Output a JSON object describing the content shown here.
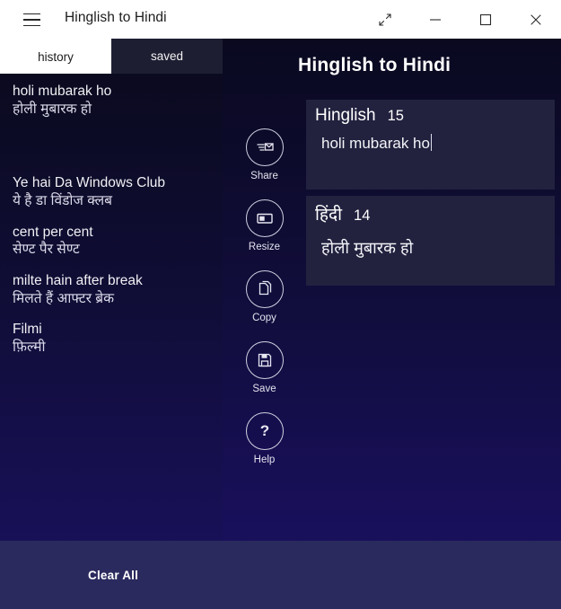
{
  "window": {
    "title": "Hinglish to Hindi",
    "menu_icon": "hamburger-icon",
    "buttons": [
      {
        "name": "restore-fullscreen-button",
        "icon": "diagonal-arrows-icon",
        "label": ""
      },
      {
        "name": "minimize-button",
        "icon": "minimize-icon",
        "label": ""
      },
      {
        "name": "maximize-button",
        "icon": "maximize-icon",
        "label": ""
      },
      {
        "name": "close-button",
        "icon": "close-icon",
        "label": ""
      }
    ]
  },
  "tabs": [
    {
      "label": "history",
      "active": true
    },
    {
      "label": "saved",
      "active": false
    }
  ],
  "history": [
    {
      "source": "holi mubarak ho",
      "target": "होली मुबारक हो"
    },
    {
      "source": "",
      "target": ""
    },
    {
      "source": "Ye hai Da Windows Club",
      "target": "ये है डा विंडोज क्लब"
    },
    {
      "source": "cent per cent",
      "target": "सेण्ट पैर सेण्ट"
    },
    {
      "source": "milte hain after break",
      "target": "मिलते हैं आफ्टर ब्रेक"
    },
    {
      "source": "Filmi",
      "target": "फ़िल्मी"
    }
  ],
  "clear_all": {
    "label": "Clear All"
  },
  "rail": [
    {
      "label": "Share",
      "icon": "share-icon"
    },
    {
      "label": "Resize",
      "icon": "resize-icon"
    },
    {
      "label": "Copy",
      "icon": "copy-icon"
    },
    {
      "label": "Save",
      "icon": "save-icon"
    },
    {
      "label": "Help",
      "icon": "help-icon"
    }
  ],
  "main": {
    "title": "Hinglish to Hindi",
    "source_box": {
      "language": "Hinglish",
      "count": "15",
      "value": "holi mubarak ho",
      "placeholder": ""
    },
    "target_box": {
      "language": "हिंदी",
      "count": "14",
      "value": "होली मुबारक हो",
      "placeholder": ""
    }
  },
  "colors": {
    "titlebar_bg": "#ffffff",
    "panel_dark": "#0a0a1c",
    "panel_indigo": "#1a1260",
    "textbox_bg": "#22223f",
    "clear_bar_bg": "#2a2a5e",
    "tab_active_bg": "#ffffff",
    "tab_inactive_bg": "#1e1e33",
    "text_light": "#f0f0f5"
  }
}
